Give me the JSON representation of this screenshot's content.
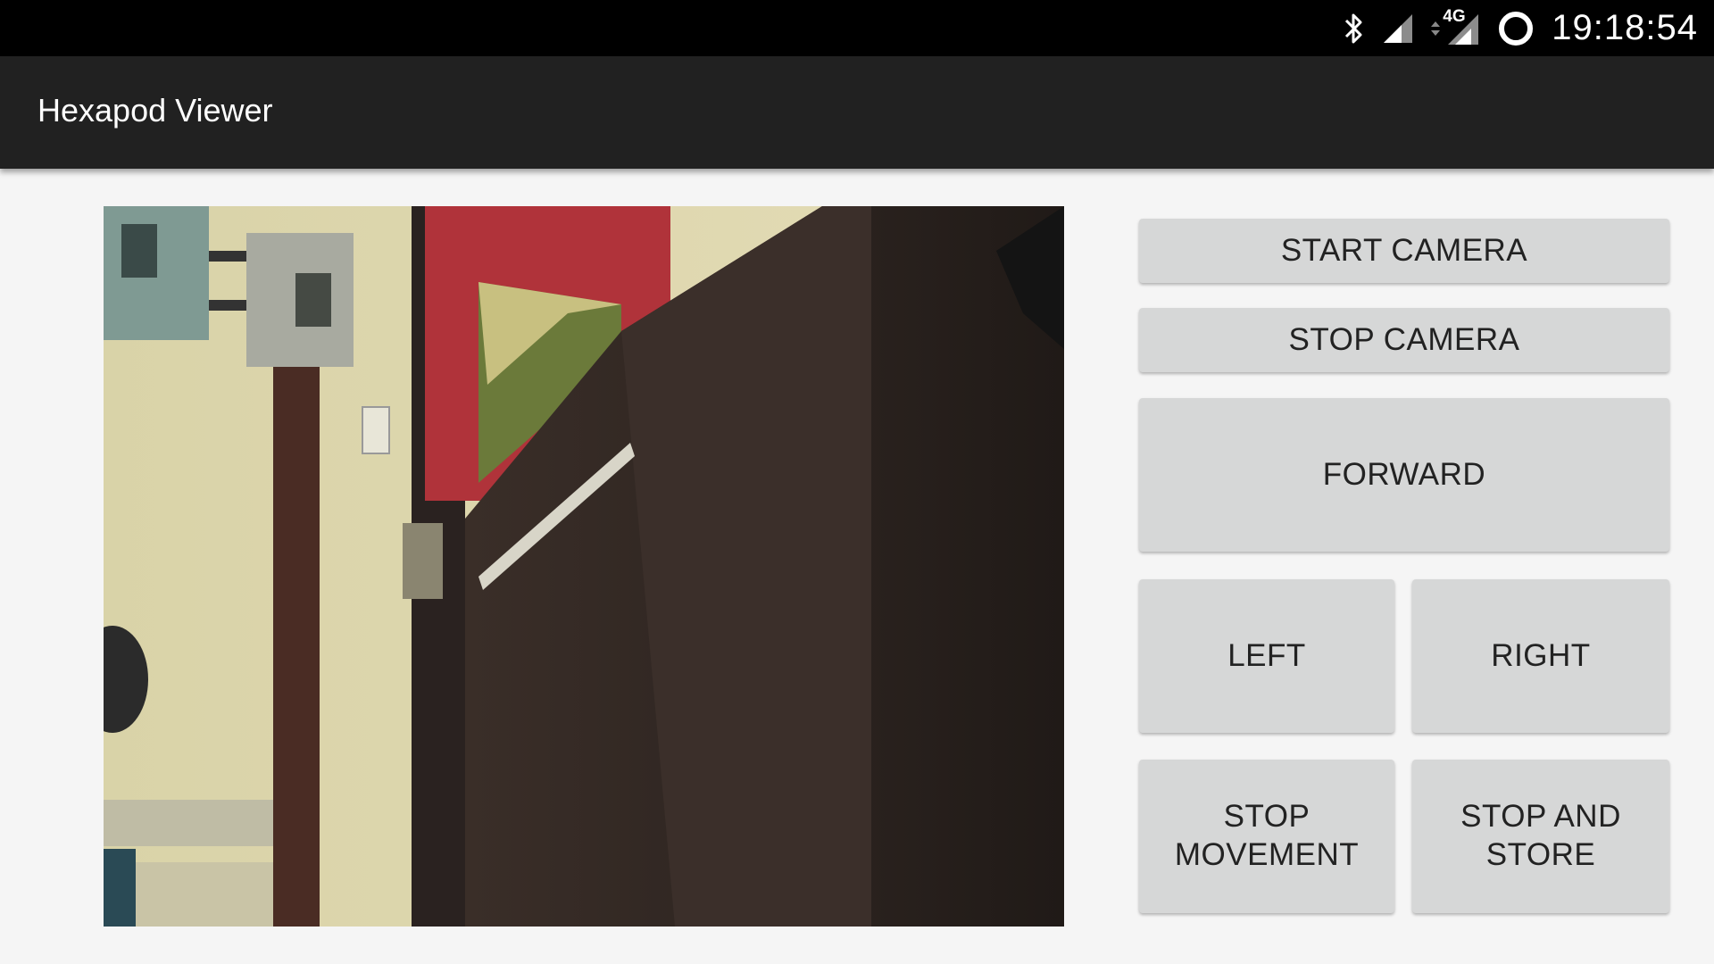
{
  "status_bar": {
    "time": "19:18:54",
    "network_label": "4G",
    "icons": [
      "bluetooth-icon",
      "signal-icon",
      "data-arrows-icon",
      "lte-signal-icon",
      "sync-ring-icon"
    ]
  },
  "app_bar": {
    "title": "Hexapod Viewer"
  },
  "camera": {
    "feed": "camera-feed-image"
  },
  "controls": {
    "start_camera": "START CAMERA",
    "stop_camera": "STOP CAMERA",
    "forward": "FORWARD",
    "left": "LEFT",
    "right": "RIGHT",
    "stop_movement": "STOP MOVEMENT",
    "stop_and_store": "STOP AND STORE"
  },
  "colors": {
    "status_bar": "#000000",
    "app_bar": "#212121",
    "background": "#f5f5f5",
    "button": "#d6d7d7",
    "button_text": "#222222"
  }
}
